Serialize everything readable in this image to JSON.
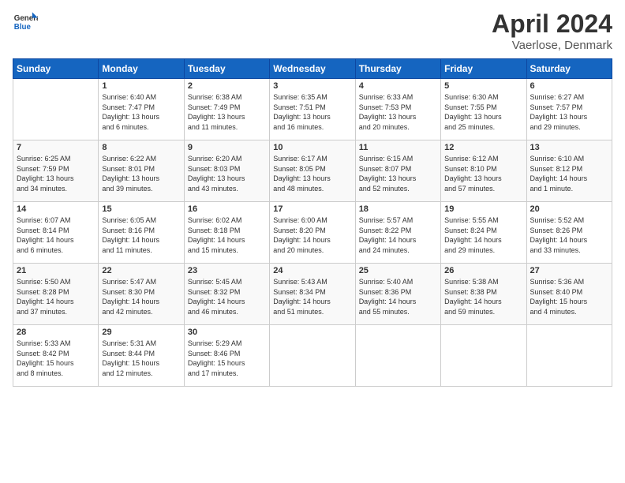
{
  "header": {
    "logo_line1": "General",
    "logo_line2": "Blue",
    "month_title": "April 2024",
    "location": "Vaerlose, Denmark"
  },
  "days_of_week": [
    "Sunday",
    "Monday",
    "Tuesday",
    "Wednesday",
    "Thursday",
    "Friday",
    "Saturday"
  ],
  "weeks": [
    [
      {
        "num": "",
        "info": ""
      },
      {
        "num": "1",
        "info": "Sunrise: 6:40 AM\nSunset: 7:47 PM\nDaylight: 13 hours\nand 6 minutes."
      },
      {
        "num": "2",
        "info": "Sunrise: 6:38 AM\nSunset: 7:49 PM\nDaylight: 13 hours\nand 11 minutes."
      },
      {
        "num": "3",
        "info": "Sunrise: 6:35 AM\nSunset: 7:51 PM\nDaylight: 13 hours\nand 16 minutes."
      },
      {
        "num": "4",
        "info": "Sunrise: 6:33 AM\nSunset: 7:53 PM\nDaylight: 13 hours\nand 20 minutes."
      },
      {
        "num": "5",
        "info": "Sunrise: 6:30 AM\nSunset: 7:55 PM\nDaylight: 13 hours\nand 25 minutes."
      },
      {
        "num": "6",
        "info": "Sunrise: 6:27 AM\nSunset: 7:57 PM\nDaylight: 13 hours\nand 29 minutes."
      }
    ],
    [
      {
        "num": "7",
        "info": "Sunrise: 6:25 AM\nSunset: 7:59 PM\nDaylight: 13 hours\nand 34 minutes."
      },
      {
        "num": "8",
        "info": "Sunrise: 6:22 AM\nSunset: 8:01 PM\nDaylight: 13 hours\nand 39 minutes."
      },
      {
        "num": "9",
        "info": "Sunrise: 6:20 AM\nSunset: 8:03 PM\nDaylight: 13 hours\nand 43 minutes."
      },
      {
        "num": "10",
        "info": "Sunrise: 6:17 AM\nSunset: 8:05 PM\nDaylight: 13 hours\nand 48 minutes."
      },
      {
        "num": "11",
        "info": "Sunrise: 6:15 AM\nSunset: 8:07 PM\nDaylight: 13 hours\nand 52 minutes."
      },
      {
        "num": "12",
        "info": "Sunrise: 6:12 AM\nSunset: 8:10 PM\nDaylight: 13 hours\nand 57 minutes."
      },
      {
        "num": "13",
        "info": "Sunrise: 6:10 AM\nSunset: 8:12 PM\nDaylight: 14 hours\nand 1 minute."
      }
    ],
    [
      {
        "num": "14",
        "info": "Sunrise: 6:07 AM\nSunset: 8:14 PM\nDaylight: 14 hours\nand 6 minutes."
      },
      {
        "num": "15",
        "info": "Sunrise: 6:05 AM\nSunset: 8:16 PM\nDaylight: 14 hours\nand 11 minutes."
      },
      {
        "num": "16",
        "info": "Sunrise: 6:02 AM\nSunset: 8:18 PM\nDaylight: 14 hours\nand 15 minutes."
      },
      {
        "num": "17",
        "info": "Sunrise: 6:00 AM\nSunset: 8:20 PM\nDaylight: 14 hours\nand 20 minutes."
      },
      {
        "num": "18",
        "info": "Sunrise: 5:57 AM\nSunset: 8:22 PM\nDaylight: 14 hours\nand 24 minutes."
      },
      {
        "num": "19",
        "info": "Sunrise: 5:55 AM\nSunset: 8:24 PM\nDaylight: 14 hours\nand 29 minutes."
      },
      {
        "num": "20",
        "info": "Sunrise: 5:52 AM\nSunset: 8:26 PM\nDaylight: 14 hours\nand 33 minutes."
      }
    ],
    [
      {
        "num": "21",
        "info": "Sunrise: 5:50 AM\nSunset: 8:28 PM\nDaylight: 14 hours\nand 37 minutes."
      },
      {
        "num": "22",
        "info": "Sunrise: 5:47 AM\nSunset: 8:30 PM\nDaylight: 14 hours\nand 42 minutes."
      },
      {
        "num": "23",
        "info": "Sunrise: 5:45 AM\nSunset: 8:32 PM\nDaylight: 14 hours\nand 46 minutes."
      },
      {
        "num": "24",
        "info": "Sunrise: 5:43 AM\nSunset: 8:34 PM\nDaylight: 14 hours\nand 51 minutes."
      },
      {
        "num": "25",
        "info": "Sunrise: 5:40 AM\nSunset: 8:36 PM\nDaylight: 14 hours\nand 55 minutes."
      },
      {
        "num": "26",
        "info": "Sunrise: 5:38 AM\nSunset: 8:38 PM\nDaylight: 14 hours\nand 59 minutes."
      },
      {
        "num": "27",
        "info": "Sunrise: 5:36 AM\nSunset: 8:40 PM\nDaylight: 15 hours\nand 4 minutes."
      }
    ],
    [
      {
        "num": "28",
        "info": "Sunrise: 5:33 AM\nSunset: 8:42 PM\nDaylight: 15 hours\nand 8 minutes."
      },
      {
        "num": "29",
        "info": "Sunrise: 5:31 AM\nSunset: 8:44 PM\nDaylight: 15 hours\nand 12 minutes."
      },
      {
        "num": "30",
        "info": "Sunrise: 5:29 AM\nSunset: 8:46 PM\nDaylight: 15 hours\nand 17 minutes."
      },
      {
        "num": "",
        "info": ""
      },
      {
        "num": "",
        "info": ""
      },
      {
        "num": "",
        "info": ""
      },
      {
        "num": "",
        "info": ""
      }
    ]
  ]
}
